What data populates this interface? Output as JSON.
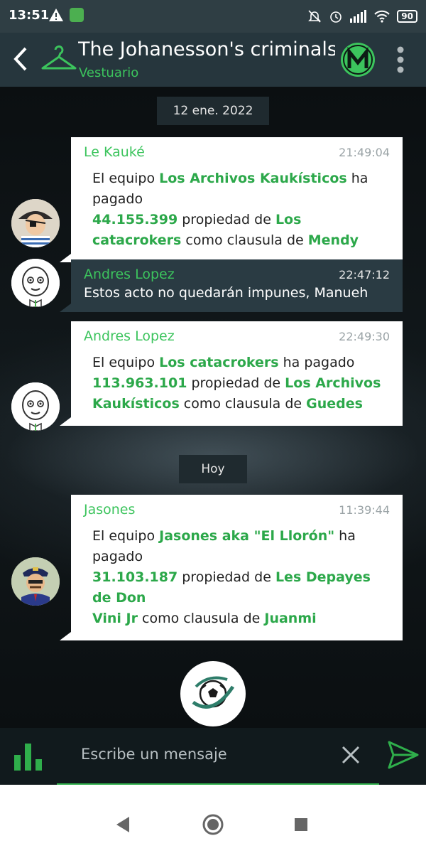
{
  "status_bar": {
    "time": "13:51",
    "battery": "90"
  },
  "header": {
    "title": "The Johanesson's criminals le",
    "subtitle": "Vestuario"
  },
  "messages": [
    {
      "type": "date",
      "label": "12 ene. 2022"
    },
    {
      "sender": "Le Kauké",
      "time": "21:49:04",
      "style": "light",
      "parts": [
        {
          "t": "El equipo "
        },
        {
          "t": "Los Archivos Kaukísticos",
          "hl": true
        },
        {
          "t": " ha pagado "
        },
        {
          "t": "44.155.399",
          "hl": true
        },
        {
          "t": " propiedad de "
        },
        {
          "t": "Los catacrokers",
          "hl": true
        },
        {
          "t": " como clausula de "
        },
        {
          "t": "Mendy",
          "hl": true
        }
      ]
    },
    {
      "sender": "Andres Lopez",
      "time": "22:47:12",
      "style": "dark",
      "parts": [
        {
          "t": "Estos acto no quedarán impunes, Manueh"
        }
      ]
    },
    {
      "sender": "Andres Lopez",
      "time": "22:49:30",
      "style": "light",
      "parts": [
        {
          "t": "El equipo "
        },
        {
          "t": "Los catacrokers",
          "hl": true
        },
        {
          "t": " ha pagado "
        },
        {
          "t": "113.963.101",
          "hl": true
        },
        {
          "t": " propiedad de "
        },
        {
          "t": "Los Archivos Kaukísticos",
          "hl": true
        },
        {
          "t": " como clausula de "
        },
        {
          "t": "Guedes",
          "hl": true
        }
      ]
    },
    {
      "type": "date",
      "label": "Hoy"
    },
    {
      "sender": "Jasones",
      "time": "11:39:44",
      "style": "light",
      "parts": [
        {
          "t": "El equipo "
        },
        {
          "t": "Jasones aka \"El Llorón\"",
          "hl": true
        },
        {
          "t": " ha pagado "
        },
        {
          "t": "31.103.187",
          "hl": true
        },
        {
          "t": " propiedad de "
        },
        {
          "t": "Les Depayes de Don Vini Jr",
          "hl": true
        },
        {
          "t": " como clausula de "
        },
        {
          "t": "Juanmi",
          "hl": true
        }
      ]
    }
  ],
  "input": {
    "placeholder": "Escribe un mensaje"
  },
  "colors": {
    "accent": "#3cc45d",
    "header": "#26363d",
    "bubble_dark": "#2a3b43"
  },
  "icons": [
    "back-arrow-icon",
    "hanger-icon",
    "league-logo-icon",
    "more-vert-icon",
    "stats-icon",
    "close-icon",
    "send-icon",
    "football-icon"
  ]
}
